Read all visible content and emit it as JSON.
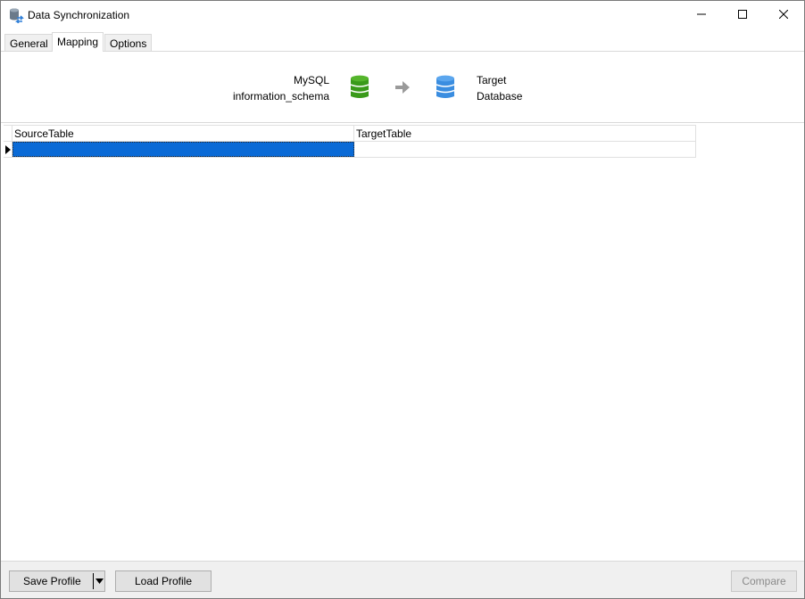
{
  "window": {
    "title": "Data Synchronization"
  },
  "tabs": [
    {
      "label": "General",
      "active": false
    },
    {
      "label": "Mapping",
      "active": true
    },
    {
      "label": "Options",
      "active": false
    }
  ],
  "source": {
    "line1": "MySQL",
    "line2": "information_schema",
    "icon": "database-icon",
    "color": "#3a9a1a"
  },
  "target": {
    "line1": "Target",
    "line2": "Database",
    "icon": "database-icon",
    "color": "#3a8de0"
  },
  "arrow": {
    "icon": "arrow-right-icon",
    "color": "#9a9a9a"
  },
  "grid": {
    "columns": [
      "SourceTable",
      "TargetTable"
    ],
    "rows": [
      {
        "SourceTable": "",
        "TargetTable": "",
        "selected": true
      }
    ],
    "selection_color": "#0a6ad6"
  },
  "footer": {
    "save_label": "Save Profile",
    "load_label": "Load Profile",
    "compare_label": "Compare",
    "compare_enabled": false
  }
}
